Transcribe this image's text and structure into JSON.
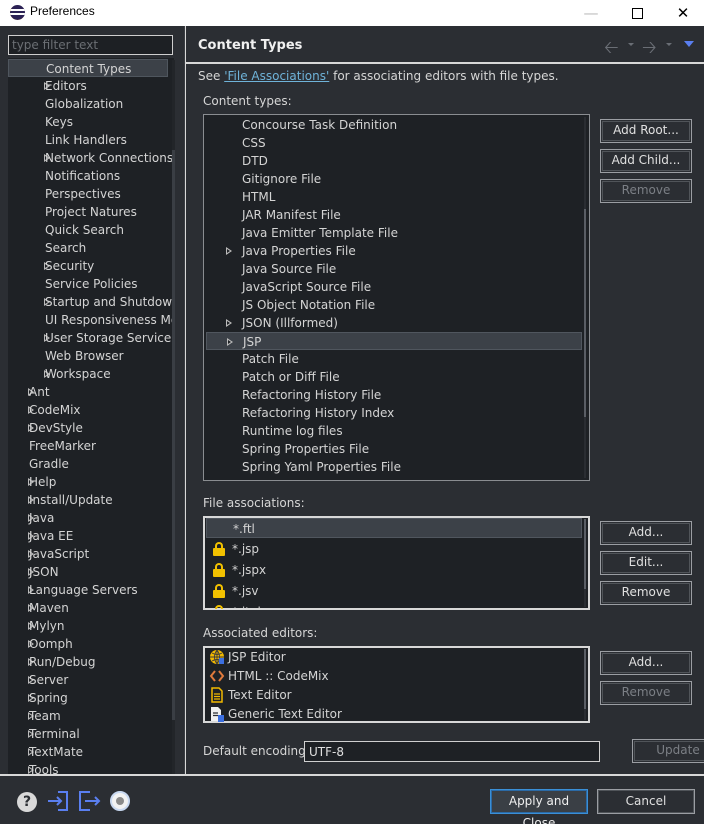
{
  "window": {
    "title": "Preferences",
    "minimize_icon": "minimize-icon",
    "maximize_icon": "maximize-icon",
    "close_icon": "close-icon"
  },
  "sidebar": {
    "filter_placeholder": "type filter text",
    "filter_value": "",
    "items": [
      {
        "label": "Content Types",
        "level": 1,
        "expandable": false,
        "selected": true
      },
      {
        "label": "Editors",
        "level": 1,
        "expandable": true
      },
      {
        "label": "Globalization",
        "level": 1,
        "expandable": false
      },
      {
        "label": "Keys",
        "level": 1,
        "expandable": false
      },
      {
        "label": "Link Handlers",
        "level": 1,
        "expandable": false
      },
      {
        "label": "Network Connections",
        "level": 1,
        "expandable": true
      },
      {
        "label": "Notifications",
        "level": 1,
        "expandable": false
      },
      {
        "label": "Perspectives",
        "level": 1,
        "expandable": false
      },
      {
        "label": "Project Natures",
        "level": 1,
        "expandable": false
      },
      {
        "label": "Quick Search",
        "level": 1,
        "expandable": false
      },
      {
        "label": "Search",
        "level": 1,
        "expandable": false
      },
      {
        "label": "Security",
        "level": 1,
        "expandable": true
      },
      {
        "label": "Service Policies",
        "level": 1,
        "expandable": false
      },
      {
        "label": "Startup and Shutdown",
        "level": 1,
        "expandable": true
      },
      {
        "label": "UI Responsiveness Mor",
        "level": 1,
        "expandable": false
      },
      {
        "label": "User Storage Service",
        "level": 1,
        "expandable": true
      },
      {
        "label": "Web Browser",
        "level": 1,
        "expandable": false
      },
      {
        "label": "Workspace",
        "level": 1,
        "expandable": true
      },
      {
        "label": "Ant",
        "level": 0,
        "expandable": true
      },
      {
        "label": "CodeMix",
        "level": 0,
        "expandable": true
      },
      {
        "label": "DevStyle",
        "level": 0,
        "expandable": true
      },
      {
        "label": "FreeMarker",
        "level": 0,
        "expandable": false
      },
      {
        "label": "Gradle",
        "level": 0,
        "expandable": false
      },
      {
        "label": "Help",
        "level": 0,
        "expandable": true
      },
      {
        "label": "Install/Update",
        "level": 0,
        "expandable": true
      },
      {
        "label": "Java",
        "level": 0,
        "expandable": true
      },
      {
        "label": "Java EE",
        "level": 0,
        "expandable": true
      },
      {
        "label": "JavaScript",
        "level": 0,
        "expandable": true
      },
      {
        "label": "JSON",
        "level": 0,
        "expandable": true
      },
      {
        "label": "Language Servers",
        "level": 0,
        "expandable": true
      },
      {
        "label": "Maven",
        "level": 0,
        "expandable": true
      },
      {
        "label": "Mylyn",
        "level": 0,
        "expandable": true
      },
      {
        "label": "Oomph",
        "level": 0,
        "expandable": true
      },
      {
        "label": "Run/Debug",
        "level": 0,
        "expandable": true
      },
      {
        "label": "Server",
        "level": 0,
        "expandable": true
      },
      {
        "label": "Spring",
        "level": 0,
        "expandable": true
      },
      {
        "label": "Team",
        "level": 0,
        "expandable": true
      },
      {
        "label": "Terminal",
        "level": 0,
        "expandable": true
      },
      {
        "label": "TextMate",
        "level": 0,
        "expandable": true
      },
      {
        "label": "Tools",
        "level": 0,
        "expandable": true
      }
    ]
  },
  "page": {
    "title": "Content Types",
    "intro_prefix": "See ",
    "intro_link": "'File Associations'",
    "intro_suffix": " for associating editors with file types.",
    "content_types_label": "Content types:",
    "content_types": [
      {
        "label": "Concourse Task Definition",
        "expandable": false
      },
      {
        "label": "CSS",
        "expandable": false
      },
      {
        "label": "DTD",
        "expandable": false
      },
      {
        "label": "Gitignore File",
        "expandable": false
      },
      {
        "label": "HTML",
        "expandable": false
      },
      {
        "label": "JAR Manifest File",
        "expandable": false
      },
      {
        "label": "Java Emitter Template File",
        "expandable": false
      },
      {
        "label": "Java Properties File",
        "expandable": true
      },
      {
        "label": "Java Source File",
        "expandable": false
      },
      {
        "label": "JavaScript Source File",
        "expandable": false
      },
      {
        "label": "JS Object Notation File",
        "expandable": false
      },
      {
        "label": "JSON (Illformed)",
        "expandable": true
      },
      {
        "label": "JSP",
        "expandable": true,
        "selected": true
      },
      {
        "label": "Patch File",
        "expandable": false
      },
      {
        "label": "Patch or Diff File",
        "expandable": false
      },
      {
        "label": "Refactoring History File",
        "expandable": false
      },
      {
        "label": "Refactoring History Index",
        "expandable": false
      },
      {
        "label": "Runtime log files",
        "expandable": false
      },
      {
        "label": "Spring Properties File",
        "expandable": false
      },
      {
        "label": "Spring Yaml Properties File",
        "expandable": false
      }
    ],
    "content_type_buttons": {
      "add_root": "Add Root...",
      "add_child": "Add Child...",
      "remove": "Remove"
    },
    "file_associations_label": "File associations:",
    "file_associations": [
      {
        "label": "*.ftl",
        "locked": false,
        "selected": true
      },
      {
        "label": "*.jsp",
        "locked": true
      },
      {
        "label": "*.jspx",
        "locked": true
      },
      {
        "label": "*.jsv",
        "locked": true
      },
      {
        "label": "*.jtpl",
        "locked": true
      }
    ],
    "file_association_buttons": {
      "add": "Add...",
      "edit": "Edit...",
      "remove": "Remove"
    },
    "associated_editors_label": "Associated editors:",
    "associated_editors": [
      {
        "label": "JSP Editor",
        "icon": "globe-icon"
      },
      {
        "label": "HTML :: CodeMix",
        "icon": "code-brackets-icon"
      },
      {
        "label": "Text Editor",
        "icon": "text-file-icon"
      },
      {
        "label": "Generic Text Editor",
        "icon": "generic-editor-icon"
      }
    ],
    "associated_editor_buttons": {
      "add": "Add...",
      "remove": "Remove"
    },
    "default_encoding_label": "Default encoding:",
    "default_encoding_value": "UTF-8",
    "update_button": "Update"
  },
  "footer": {
    "apply_and_close": "Apply and Close",
    "cancel": "Cancel"
  },
  "colors": {
    "link": "#6fb3d9",
    "lock": "#f2c100",
    "accent_blue": "#5a7ff0",
    "focus_border": "#3b8fd6"
  }
}
